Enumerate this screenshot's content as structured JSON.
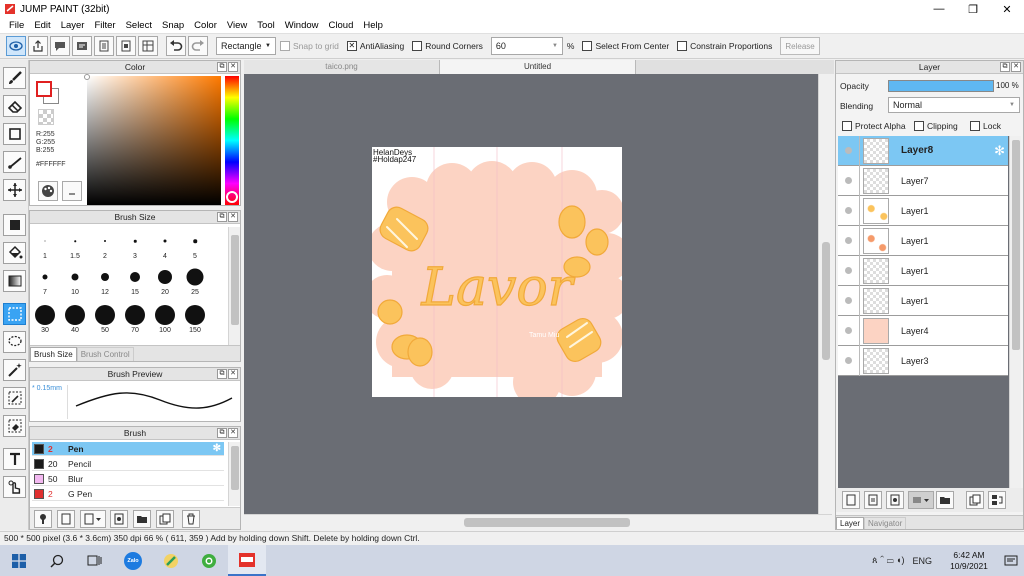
{
  "app": {
    "title": "JUMP PAINT (32bit)"
  },
  "window_buttons": {
    "minimize": "—",
    "restore": "❐",
    "close": "✕"
  },
  "menu": [
    "File",
    "Edit",
    "Layer",
    "Filter",
    "Select",
    "Snap",
    "Color",
    "View",
    "Tool",
    "Window",
    "Cloud",
    "Help"
  ],
  "toolbar": {
    "shape_select": "Rectangle",
    "snap_to_grid": "Snap to grid",
    "antialiasing": "AntiAliasing",
    "round_corners": "Round Corners",
    "corner_value": "60",
    "percent": "%",
    "select_from_center": "Select From Center",
    "constrain_proportions": "Constrain Proportions",
    "release": "Release"
  },
  "color_panel": {
    "title": "Color",
    "r": "R:255",
    "g": "G:255",
    "b": "B:255",
    "hex": "#FFFFFF",
    "colors": {
      "primary": "#ffffff",
      "secondary": "#ffffff",
      "primary_border": "#e02020"
    }
  },
  "brush_size_panel": {
    "title": "Brush Size",
    "sizes": [
      "1",
      "1.5",
      "2",
      "3",
      "4",
      "5",
      "7",
      "10",
      "12",
      "15",
      "20",
      "25",
      "30",
      "40",
      "50",
      "70",
      "100",
      "150"
    ],
    "tabs": [
      "Brush Size",
      "Brush Control"
    ]
  },
  "brush_preview_panel": {
    "title": "Brush Preview",
    "size": "0.15mm"
  },
  "brush_panel": {
    "title": "Brush",
    "brushes": [
      {
        "size": "2",
        "name": "Pen",
        "color": "#1a1a1a",
        "selected": true
      },
      {
        "size": "20",
        "name": "Pencil",
        "color": "#1a1a1a",
        "selected": false
      },
      {
        "size": "50",
        "name": "Blur",
        "color": "#f2b8f0",
        "selected": false
      },
      {
        "size": "2",
        "name": "G Pen",
        "color": "#e03030",
        "selected": false
      }
    ]
  },
  "tabs": [
    {
      "label": "taico.png",
      "active": false
    },
    {
      "label": "Untitled",
      "active": true
    }
  ],
  "canvas": {
    "watermark_line1": "HelanDeys",
    "watermark_line2": "#Holdap247",
    "lettering": "Lavor",
    "signature": "Tamu Miu",
    "colors": {
      "background": "#ffffff",
      "cloud": "#fcd3c3",
      "accent": "#fbc35c"
    }
  },
  "layer_panel": {
    "title": "Layer",
    "opacity_label": "Opacity",
    "opacity_value": "100 %",
    "opacity_fraction": 1.0,
    "blending_label": "Blending",
    "blending_value": "Normal",
    "protect_alpha": "Protect Alpha",
    "clipping": "Clipping",
    "lock": "Lock",
    "layers": [
      {
        "name": "Layer8",
        "selected": true
      },
      {
        "name": "Layer7",
        "selected": false
      },
      {
        "name": "Layer1",
        "selected": false
      },
      {
        "name": "Layer1",
        "selected": false
      },
      {
        "name": "Layer1",
        "selected": false
      },
      {
        "name": "Layer1",
        "selected": false
      },
      {
        "name": "Layer4",
        "selected": false
      },
      {
        "name": "Layer3",
        "selected": false
      }
    ],
    "tabs": [
      "Layer",
      "Navigator"
    ]
  },
  "status_bar": {
    "text": "500 * 500 pixel  (3.6 * 3.6cm)  350 dpi  66 %  ( 611, 359 )  Add by holding down Shift. Delete by holding down Ctrl."
  },
  "taskbar": {
    "lang": "ENG",
    "time": "6:42 AM",
    "date": "10/9/2021",
    "zalo_label": "Zalo",
    "tray_icons": "ጰ ⌃ ▭ ◖)"
  }
}
